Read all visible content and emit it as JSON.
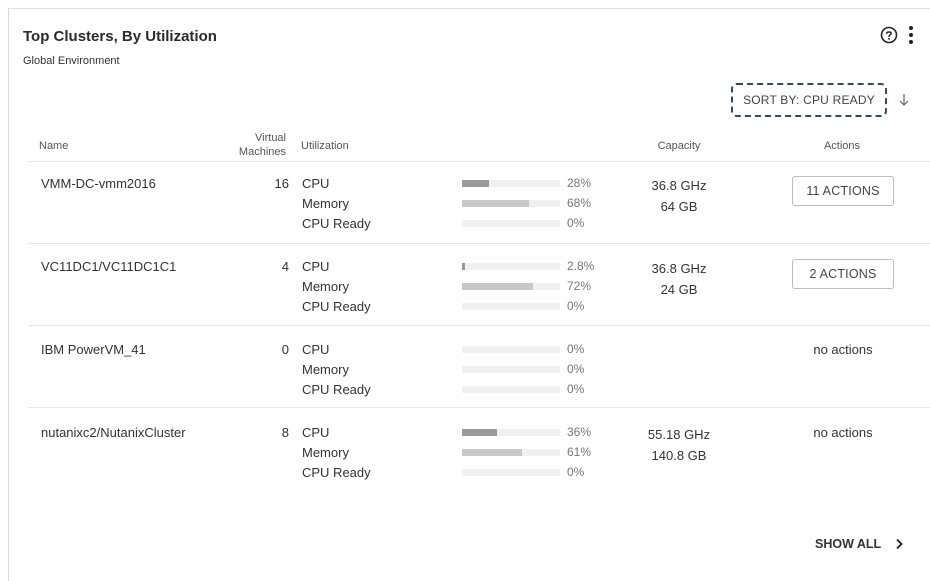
{
  "header": {
    "title": "Top Clusters, By Utilization",
    "subtitle": "Global Environment",
    "help_icon": "help-circle-icon",
    "more_icon": "more-vertical-icon"
  },
  "sort": {
    "label": "SORT BY: CPU READY",
    "direction_icon": "arrow-down-icon"
  },
  "columns": {
    "name": "Name",
    "vm_line1": "Virtual",
    "vm_line2": "Machines",
    "utilization": "Utilization",
    "capacity": "Capacity",
    "actions": "Actions"
  },
  "rows": [
    {
      "name": "VMM-DC-vmm2016",
      "vms": "16",
      "metrics": [
        {
          "label": "CPU",
          "pct": "28%",
          "fraction": 0.28
        },
        {
          "label": "Memory",
          "pct": "68%",
          "fraction": 0.68
        },
        {
          "label": "CPU Ready",
          "pct": "0%",
          "fraction": 0
        }
      ],
      "capacity": [
        "36.8 GHz",
        "64 GB"
      ],
      "action": "11 ACTIONS",
      "action_is_button": true
    },
    {
      "name": "VC11DC1/VC11DC1C1",
      "vms": "4",
      "metrics": [
        {
          "label": "CPU",
          "pct": "2.8%",
          "fraction": 0.028
        },
        {
          "label": "Memory",
          "pct": "72%",
          "fraction": 0.72
        },
        {
          "label": "CPU Ready",
          "pct": "0%",
          "fraction": 0
        }
      ],
      "capacity": [
        "36.8 GHz",
        "24 GB"
      ],
      "action": "2 ACTIONS",
      "action_is_button": true
    },
    {
      "name": "IBM PowerVM_41",
      "vms": "0",
      "metrics": [
        {
          "label": "CPU",
          "pct": "0%",
          "fraction": 0
        },
        {
          "label": "Memory",
          "pct": "0%",
          "fraction": 0
        },
        {
          "label": "CPU Ready",
          "pct": "0%",
          "fraction": 0
        }
      ],
      "capacity": [
        "",
        ""
      ],
      "action": "no actions",
      "action_is_button": false
    },
    {
      "name": "nutanixc2/NutanixCluster",
      "vms": "8",
      "metrics": [
        {
          "label": "CPU",
          "pct": "36%",
          "fraction": 0.36
        },
        {
          "label": "Memory",
          "pct": "61%",
          "fraction": 0.61
        },
        {
          "label": "CPU Ready",
          "pct": "0%",
          "fraction": 0
        }
      ],
      "capacity": [
        "55.18 GHz",
        "140.8 GB"
      ],
      "action": "no actions",
      "action_is_button": false
    }
  ],
  "footer": {
    "show_all": "SHOW ALL",
    "chevron_icon": "chevron-right-icon"
  }
}
